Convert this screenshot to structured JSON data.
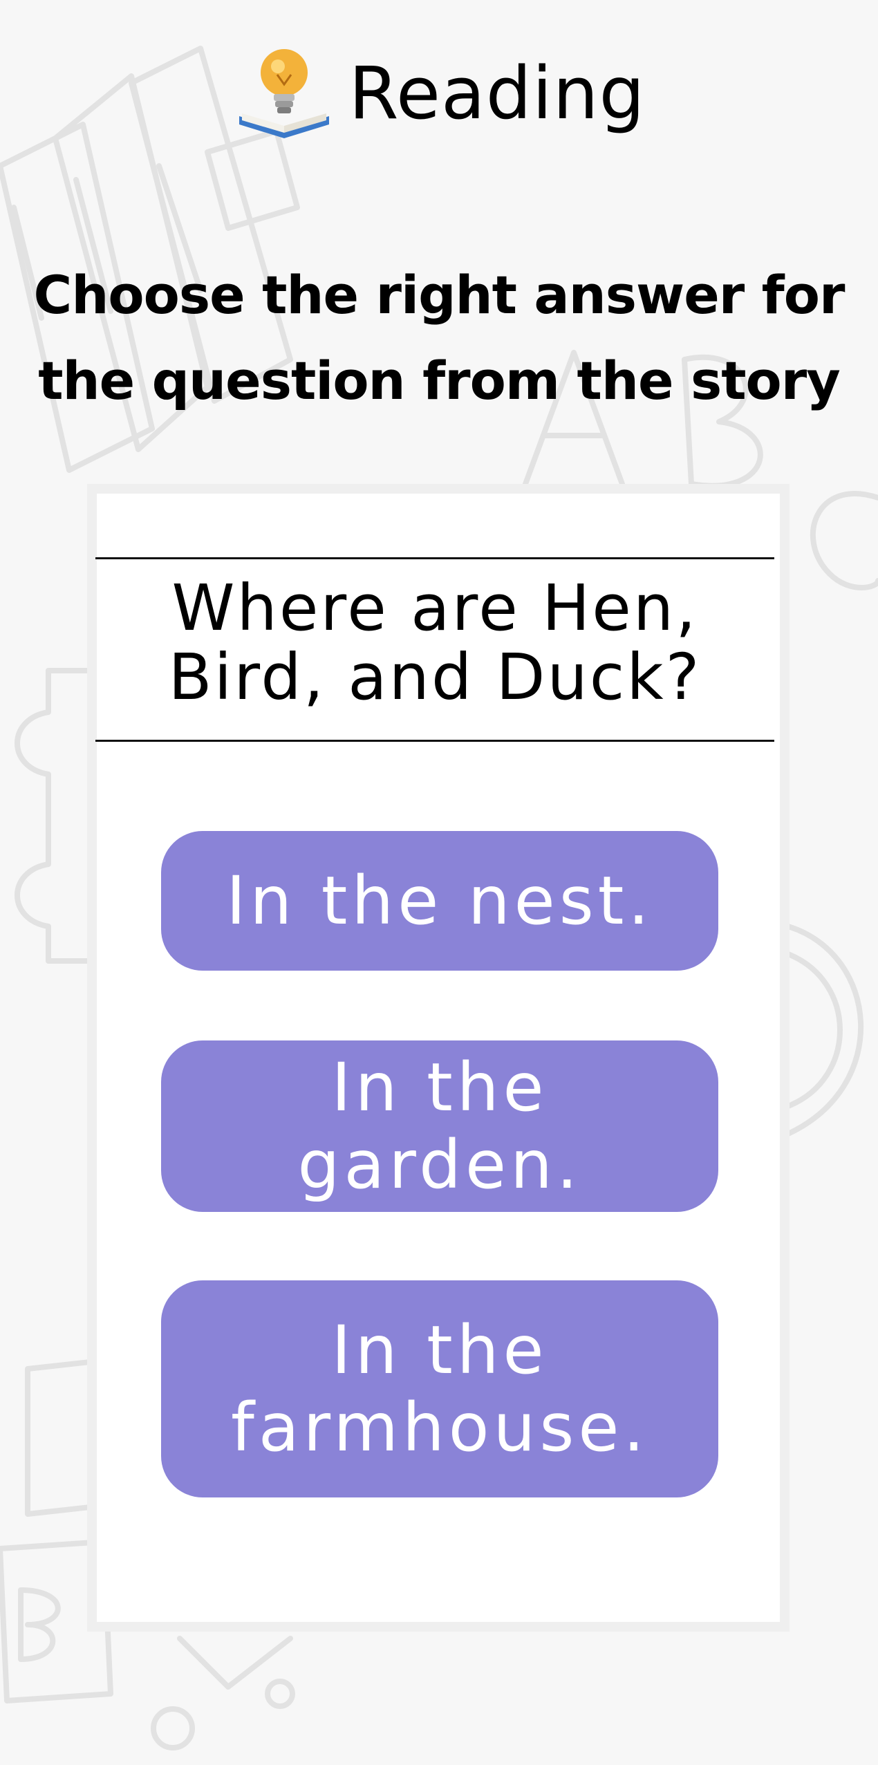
{
  "header": {
    "logo_icon": "lightbulb-book-icon",
    "title": "Reading"
  },
  "instruction": "Choose the right answer for the question from the story",
  "question": "Where are Hen, Bird, and Duck?",
  "answers": [
    {
      "label": "In the nest."
    },
    {
      "label": "In the garden."
    },
    {
      "label": "In the farmhouse."
    }
  ],
  "colors": {
    "background": "#f7f7f7",
    "card": "#ffffff",
    "answer_button": "#8a83d7",
    "doodle": "#e2e2e2"
  }
}
